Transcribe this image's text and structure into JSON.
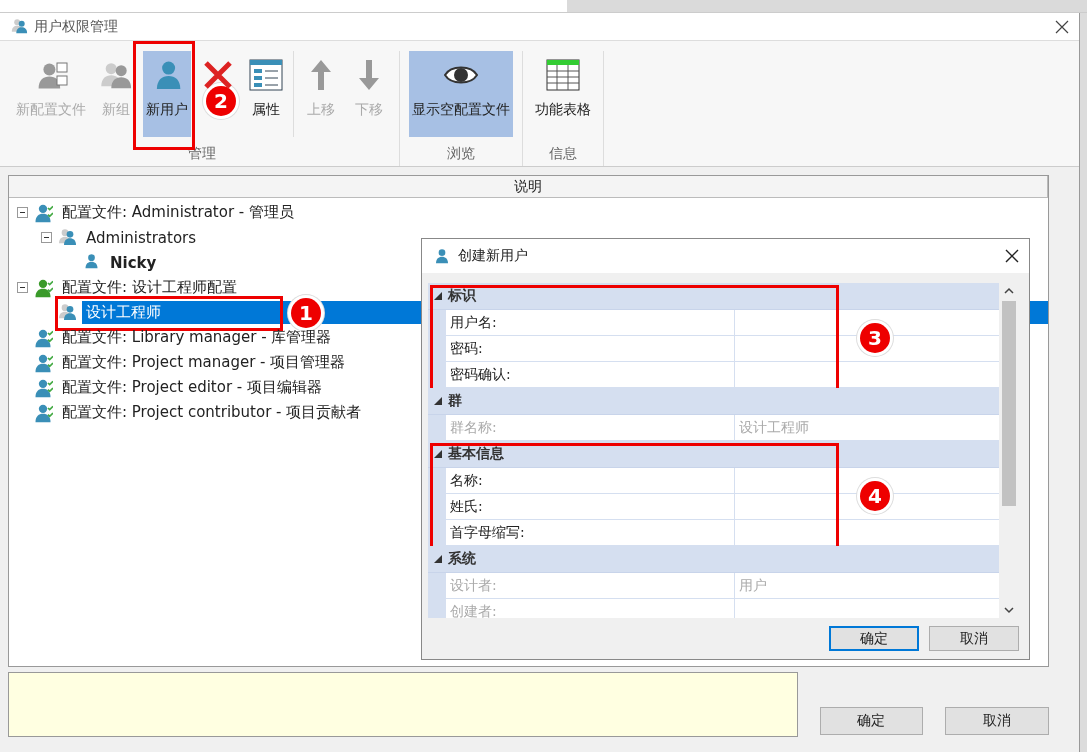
{
  "window": {
    "title": "用户权限管理"
  },
  "toolbar": {
    "groups": [
      {
        "label": "管理",
        "sections": [
          [
            {
              "label": "新配置文件",
              "kind": "profile",
              "disabled": true,
              "selected": false
            },
            {
              "label": "新组",
              "kind": "group",
              "disabled": true,
              "selected": false
            },
            {
              "label": "新用户",
              "kind": "user",
              "disabled": false,
              "selected": true,
              "callout": "2"
            },
            {
              "kind": "delete",
              "selected": false
            },
            {
              "label": "属性",
              "kind": "properties",
              "disabled": false,
              "selected": false
            }
          ],
          [
            {
              "label": "上移",
              "kind": "up",
              "disabled": true,
              "selected": false
            },
            {
              "label": "下移",
              "kind": "down",
              "disabled": true,
              "selected": false
            }
          ]
        ]
      },
      {
        "label": "浏览",
        "sections": [
          [
            {
              "label": "显示空配置文件",
              "kind": "eye",
              "disabled": false,
              "selected": true
            }
          ]
        ]
      },
      {
        "label": "信息",
        "sections": [
          [
            {
              "label": "功能表格",
              "kind": "table",
              "disabled": false,
              "selected": false
            }
          ]
        ]
      }
    ]
  },
  "tree": {
    "column": "说明",
    "items": [
      {
        "label": "配置文件: Administrator - 管理员",
        "kind": "profile",
        "active": false,
        "expanded": true,
        "selected": false,
        "children": [
          {
            "label": "Administrators",
            "kind": "group",
            "expanded": true,
            "selected": false,
            "children": [
              {
                "label": "Nicky",
                "kind": "user",
                "selected": false
              }
            ]
          }
        ]
      },
      {
        "label": "配置文件: 设计工程师配置",
        "kind": "profile",
        "active": true,
        "expanded": true,
        "selected": false,
        "children": [
          {
            "label": "设计工程师",
            "kind": "group",
            "selected": true,
            "callout": "1"
          }
        ]
      },
      {
        "label": "配置文件: Library manager - 库管理器",
        "kind": "profile",
        "active": false,
        "selected": false
      },
      {
        "label": "配置文件: Project manager - 项目管理器",
        "kind": "profile",
        "active": false,
        "selected": false
      },
      {
        "label": "配置文件: Project editor - 项目编辑器",
        "kind": "profile",
        "active": false,
        "selected": false
      },
      {
        "label": "配置文件: Project contributor - 项目贡献者",
        "kind": "profile",
        "active": false,
        "selected": false
      }
    ]
  },
  "footer": {
    "buttons": [
      {
        "label": "确定"
      },
      {
        "label": "取消"
      }
    ]
  },
  "dialog": {
    "title": "创建新用户",
    "sections": [
      {
        "title": "标识",
        "expanded": true,
        "callout": "3",
        "rows": [
          {
            "label": "用户名:",
            "disabled": false
          },
          {
            "label": "密码:",
            "disabled": false
          },
          {
            "label": "密码确认:",
            "disabled": false
          }
        ]
      },
      {
        "title": "群",
        "expanded": true,
        "rows": [
          {
            "label": "群名称:",
            "value": "设计工程师",
            "disabled": true
          }
        ]
      },
      {
        "title": "基本信息",
        "expanded": true,
        "callout": "4",
        "rows": [
          {
            "label": "名称:",
            "disabled": false
          },
          {
            "label": "姓氏:",
            "disabled": false
          },
          {
            "label": "首字母缩写:",
            "disabled": false
          }
        ]
      },
      {
        "title": "系统",
        "expanded": true,
        "rows": [
          {
            "label": "设计者:",
            "value": "用户",
            "disabled": true
          },
          {
            "label": "创建者:",
            "disabled": true
          }
        ]
      }
    ],
    "buttons": [
      {
        "label": "确定",
        "default": true
      },
      {
        "label": "取消",
        "default": false
      }
    ]
  }
}
